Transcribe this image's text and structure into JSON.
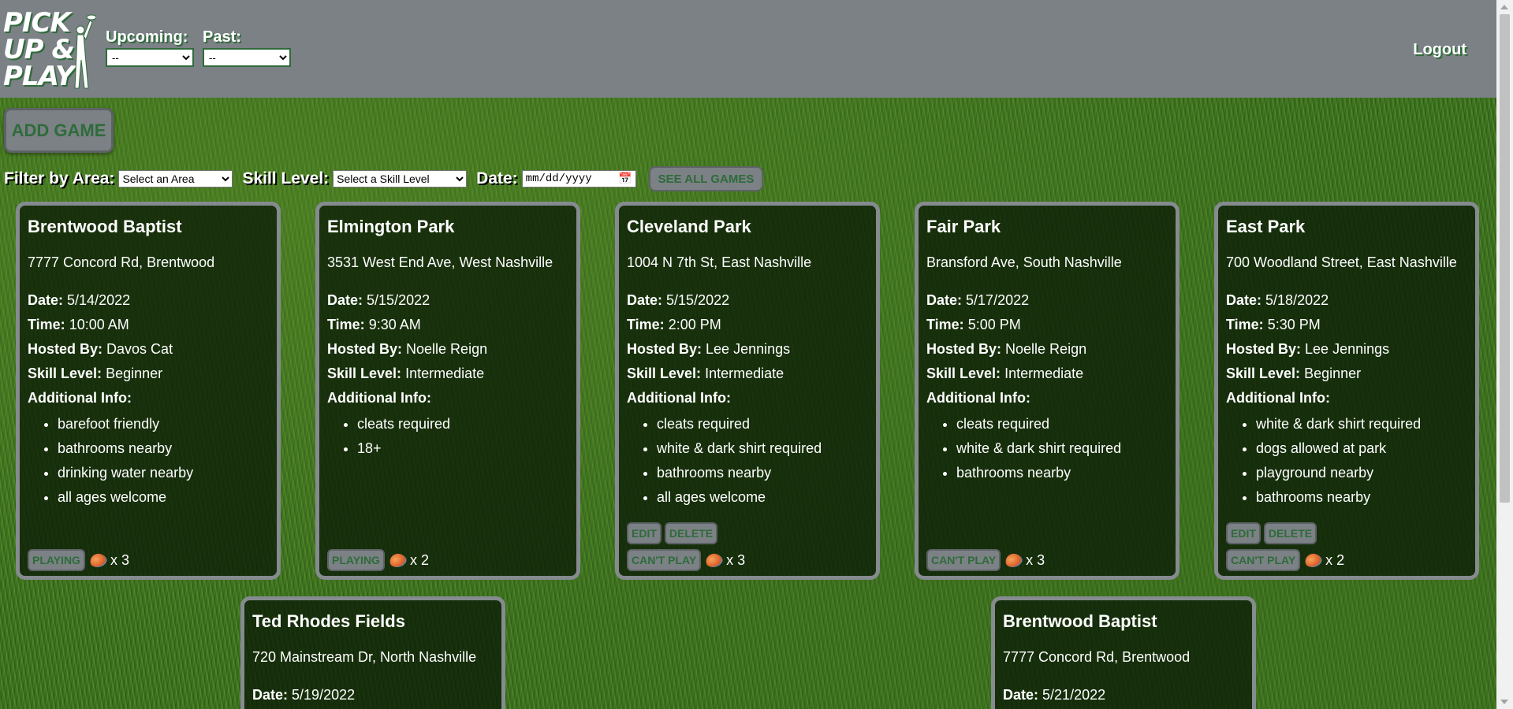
{
  "header": {
    "logo_text": "PICK UP & PLAY",
    "upcoming_label": "Upcoming:",
    "upcoming_value": "--",
    "past_label": "Past:",
    "past_value": "--",
    "logout_label": "Logout"
  },
  "toolbar": {
    "add_game_label": "ADD GAME",
    "filter_area_label": "Filter by Area:",
    "area_select_value": "Select an Area",
    "skill_label": "Skill Level:",
    "skill_select_value": "Select a Skill Level",
    "date_label": "Date:",
    "date_placeholder": "mm/dd/yyyy",
    "see_all_label": "SEE ALL GAMES"
  },
  "labels": {
    "date": "Date:",
    "time": "Time:",
    "hosted_by": "Hosted By:",
    "skill_level": "Skill Level:",
    "additional_info": "Additional Info:",
    "edit": "EDIT",
    "delete": "DELETE"
  },
  "games": [
    {
      "title": "Brentwood Baptist",
      "address": "7777 Concord Rd, Brentwood",
      "date": "5/14/2022",
      "time": "10:00 AM",
      "host": "Davos Cat",
      "skill": "Beginner",
      "info": [
        "barefoot friendly",
        "bathrooms nearby",
        "drinking water nearby",
        "all ages welcome"
      ],
      "status_label": "PLAYING",
      "count": "x 3"
    },
    {
      "title": "Elmington Park",
      "address": "3531 West End Ave, West Nashville",
      "date": "5/15/2022",
      "time": "9:30 AM",
      "host": "Noelle Reign",
      "skill": "Intermediate",
      "info": [
        "cleats required",
        "18+"
      ],
      "status_label": "PLAYING",
      "count": "x 2"
    },
    {
      "title": "Cleveland Park",
      "address": "1004 N 7th St, East Nashville",
      "date": "5/15/2022",
      "time": "2:00 PM",
      "host": "Lee Jennings",
      "skill": "Intermediate",
      "info": [
        "cleats required",
        "white & dark shirt required",
        "bathrooms nearby",
        "all ages welcome"
      ],
      "status_label": "CAN'T PLAY",
      "count": "x 3"
    },
    {
      "title": "Fair Park",
      "address": "Bransford Ave, South Nashville",
      "date": "5/17/2022",
      "time": "5:00 PM",
      "host": "Noelle Reign",
      "skill": "Intermediate",
      "info": [
        "cleats required",
        "white & dark shirt required",
        "bathrooms nearby"
      ],
      "status_label": "CAN'T PLAY",
      "count": "x 3"
    },
    {
      "title": "East Park",
      "address": "700 Woodland Street, East Nashville",
      "date": "5/18/2022",
      "time": "5:30 PM",
      "host": "Lee Jennings",
      "skill": "Beginner",
      "info": [
        "white & dark shirt required",
        "dogs allowed at park",
        "playground nearby",
        "bathrooms nearby"
      ],
      "status_label": "CAN'T PLAY",
      "count": "x 2"
    },
    {
      "title": "Ted Rhodes Fields",
      "address": "720 Mainstream Dr, North Nashville",
      "date": "5/19/2022"
    },
    {
      "title": "Brentwood Baptist",
      "address": "7777 Concord Rd, Brentwood",
      "date": "5/21/2022"
    }
  ]
}
